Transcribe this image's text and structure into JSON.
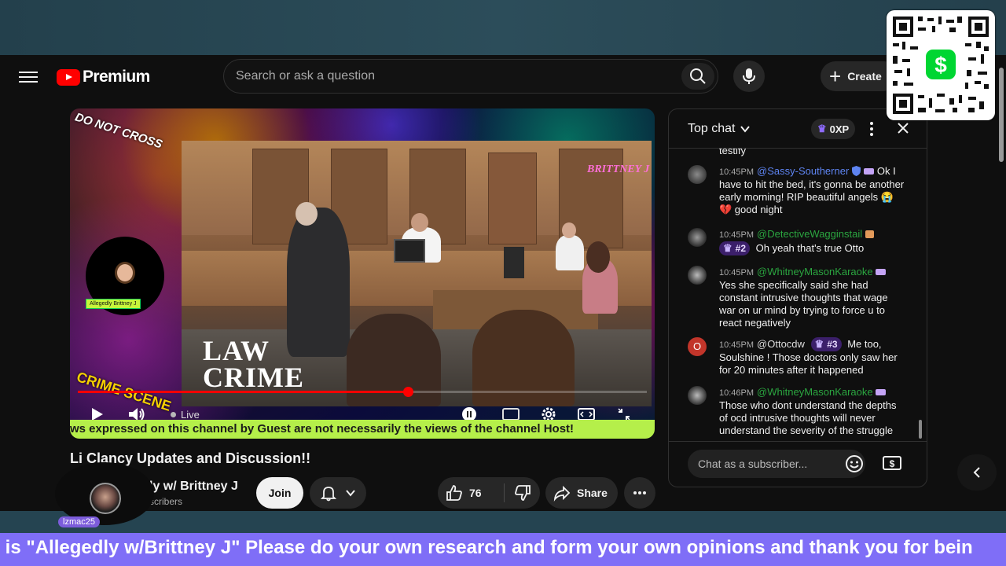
{
  "masthead": {
    "logo_text": "Premium",
    "search_placeholder": "Search or ask a question",
    "create_label": "Create"
  },
  "video": {
    "watermark_name": "BRITTNEY J",
    "watermark_cross": "DO NOT CROSS",
    "watermark_crime": "CRIME SCENE",
    "law_crime_line1": "LAW",
    "law_crime_line2": "CRIME",
    "avatar_tag": "Allegedly Brittney J",
    "live_label": "Live",
    "progress": 0.58,
    "ticker_text": "ws expressed on this channel by Guest are not necessarily the views of the channel Host!"
  },
  "below_video": {
    "title": "Li     Clancy Updates and Discussion!!",
    "channel_name": "ly w/ Brittney J",
    "subscribers": "scribers",
    "join_label": "Join",
    "like_count": "76",
    "share_label": "Share",
    "overlay_username": "lzmac25"
  },
  "chat": {
    "mode_label": "Top chat",
    "xp_label": "0XP",
    "input_placeholder": "Chat as a subscriber...",
    "truncated_top": "testify",
    "messages": [
      {
        "time": "10:45PM",
        "author": "@Sassy-Southerner",
        "rank": "",
        "text": "Ok I have to hit the bed, it's gonna be another early morning! RIP beautiful angels 😭 💔 good night"
      },
      {
        "time": "10:45PM",
        "author": "@DetectiveWagginstail",
        "rank": "#2",
        "text": "Oh yeah that's true Otto"
      },
      {
        "time": "10:45PM",
        "author": "@WhitneyMasonKaraoke",
        "rank": "",
        "text": "Yes she specifically said she had constant intrusive thoughts that wage war on ur mind by trying to force u to react negatively"
      },
      {
        "time": "10:45PM",
        "author": "@Ottocdw",
        "rank": "#3",
        "text": "Me too, Soulshine ! Those doctors only saw her for 20 minutes after it happened"
      },
      {
        "time": "10:46PM",
        "author": "@WhitneyMasonKaraoke",
        "rank": "",
        "text": "Those who dont understand the depths of ocd intrusive thoughts will never understand the severity of the struggle"
      }
    ],
    "avatar_letter": "O"
  },
  "marquee_text": "t is \"Allegedly w/Brittney J\" Please do your own research and form your own opinions and thank you for bein",
  "colors": {
    "brand_red": "#ff0000",
    "chat_author_green": "#2ba640",
    "chat_author_blue": "#5e84f1",
    "ticker_green": "#b5ef4a",
    "marquee_purple": "#7f6ef7"
  }
}
